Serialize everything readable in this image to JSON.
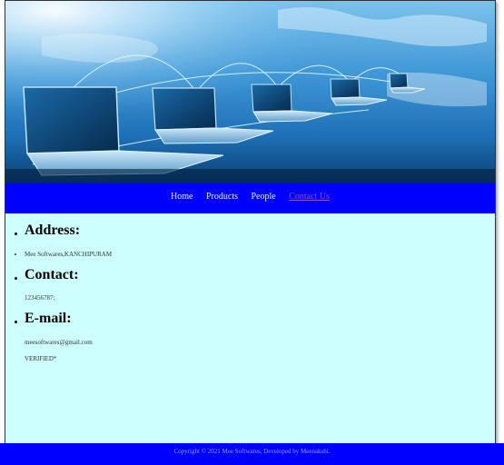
{
  "banner": {
    "image_alt": "laptops-network-world-banner"
  },
  "nav": {
    "items": [
      {
        "label": "Home"
      },
      {
        "label": "Products"
      },
      {
        "label": "People"
      },
      {
        "label": "Contact Us"
      }
    ]
  },
  "content": {
    "address_heading": "Address:",
    "address_value": "Mee Softwares,KANCHIPURAM",
    "contact_heading": "Contact:",
    "contact_value": "123456787;",
    "email_heading": "E-mail:",
    "email_value": "meesoftwares@gmail.com",
    "verified": "VERIFIED*"
  },
  "footer": {
    "text": "Copyright © 2021 Mee Softwares, Developed by Meenakshi."
  },
  "colors": {
    "nav_bg": "#0000ff",
    "content_bg": "#ccfffd",
    "active_link": "#8b4fc9"
  }
}
